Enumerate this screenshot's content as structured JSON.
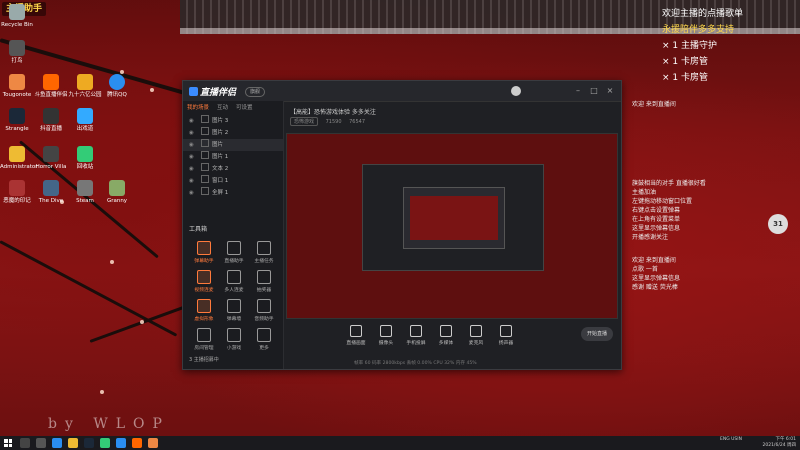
{
  "overlay": {
    "stream_title": "主播助手",
    "top_right": [
      {
        "text": "欢迎主播的点播歌单"
      },
      {
        "text": "永援陪伴多多支持"
      },
      {
        "text": "× 1  主播守护"
      },
      {
        "text": "× 1  卡房管"
      },
      {
        "text": "× 1  卡房管"
      }
    ]
  },
  "desktop": {
    "icons": [
      {
        "label": "Recycle Bin"
      },
      {
        "label": "打鸟"
      },
      {
        "label": "Tougonote"
      },
      {
        "label": "斗鱼直播伴侣"
      },
      {
        "label": "九十六亿公园"
      },
      {
        "label": "腾讯QQ"
      },
      {
        "label": "Steam"
      },
      {
        "label": "抖音直播"
      },
      {
        "label": "出戏道"
      },
      {
        "label": "Strangle"
      },
      {
        "label": "Horror Villa"
      },
      {
        "label": "回收站"
      },
      {
        "label": "Administrator"
      },
      {
        "label": "The Dive"
      },
      {
        "label": "Granny"
      },
      {
        "label": "恶魔的印记"
      }
    ]
  },
  "app": {
    "logo": "直播伴侣",
    "version": "旗舰",
    "tabs": [
      "我的场景",
      "互动",
      "可设置"
    ],
    "scenes": [
      {
        "label": "图片 3"
      },
      {
        "label": "图片 2"
      },
      {
        "label": "图片"
      },
      {
        "label": "图片 1"
      },
      {
        "label": "文本 2"
      },
      {
        "label": "窗口 1"
      },
      {
        "label": "全屏 1"
      }
    ],
    "tools_header": "工具箱",
    "tools": [
      {
        "label": "弹幕助手"
      },
      {
        "label": "直播助手"
      },
      {
        "label": "主播任务"
      },
      {
        "label": "视频连麦"
      },
      {
        "label": "多人连麦"
      },
      {
        "label": "抽奖器"
      },
      {
        "label": "虚拟形象"
      },
      {
        "label": "弹幕墙"
      },
      {
        "label": "音频助手"
      },
      {
        "label": "房间管理"
      },
      {
        "label": "小游戏"
      },
      {
        "label": "更多"
      }
    ],
    "left_footer": "3 主播招募中",
    "room_title": "【高能】恐怖游戏体验 多多关注",
    "room_meta": [
      "恐怖游戏",
      "71590",
      "76547"
    ],
    "bottom_buttons": [
      {
        "label": "直播画面"
      },
      {
        "label": "摄像头"
      },
      {
        "label": "手机投屏"
      },
      {
        "label": "多媒体"
      },
      {
        "label": "麦克风"
      },
      {
        "label": "扬声器"
      }
    ],
    "start_button": "开始直播",
    "status": "帧率 60  码率 2800kbps  丢帧 0.00%  CPU 32%  内存 45%"
  },
  "chat": {
    "lines": [
      {
        "text": "欢迎 来到直播间"
      },
      {
        "text": "旗鼓相当的对手 直播很好看"
      },
      {
        "text": "主播加油"
      },
      {
        "text": "左键拖动移动窗口位置"
      },
      {
        "text": "右键点击设置弹幕"
      },
      {
        "text": "在上角有设置菜单"
      },
      {
        "text": "这里显示弹幕信息"
      },
      {
        "text": "开播感谢关注"
      },
      {
        "text": "欢迎 来到直播间"
      },
      {
        "text": "点歌 一首"
      },
      {
        "text": "这里显示弹幕信息"
      },
      {
        "text": "感谢 赠送 荧光棒"
      }
    ],
    "badge": "31"
  },
  "watermark": "by WLOP",
  "taskbar": {
    "lang": "ENG\nUSIN",
    "time": "下午 6:01",
    "date": "2021/6/24 周四"
  }
}
